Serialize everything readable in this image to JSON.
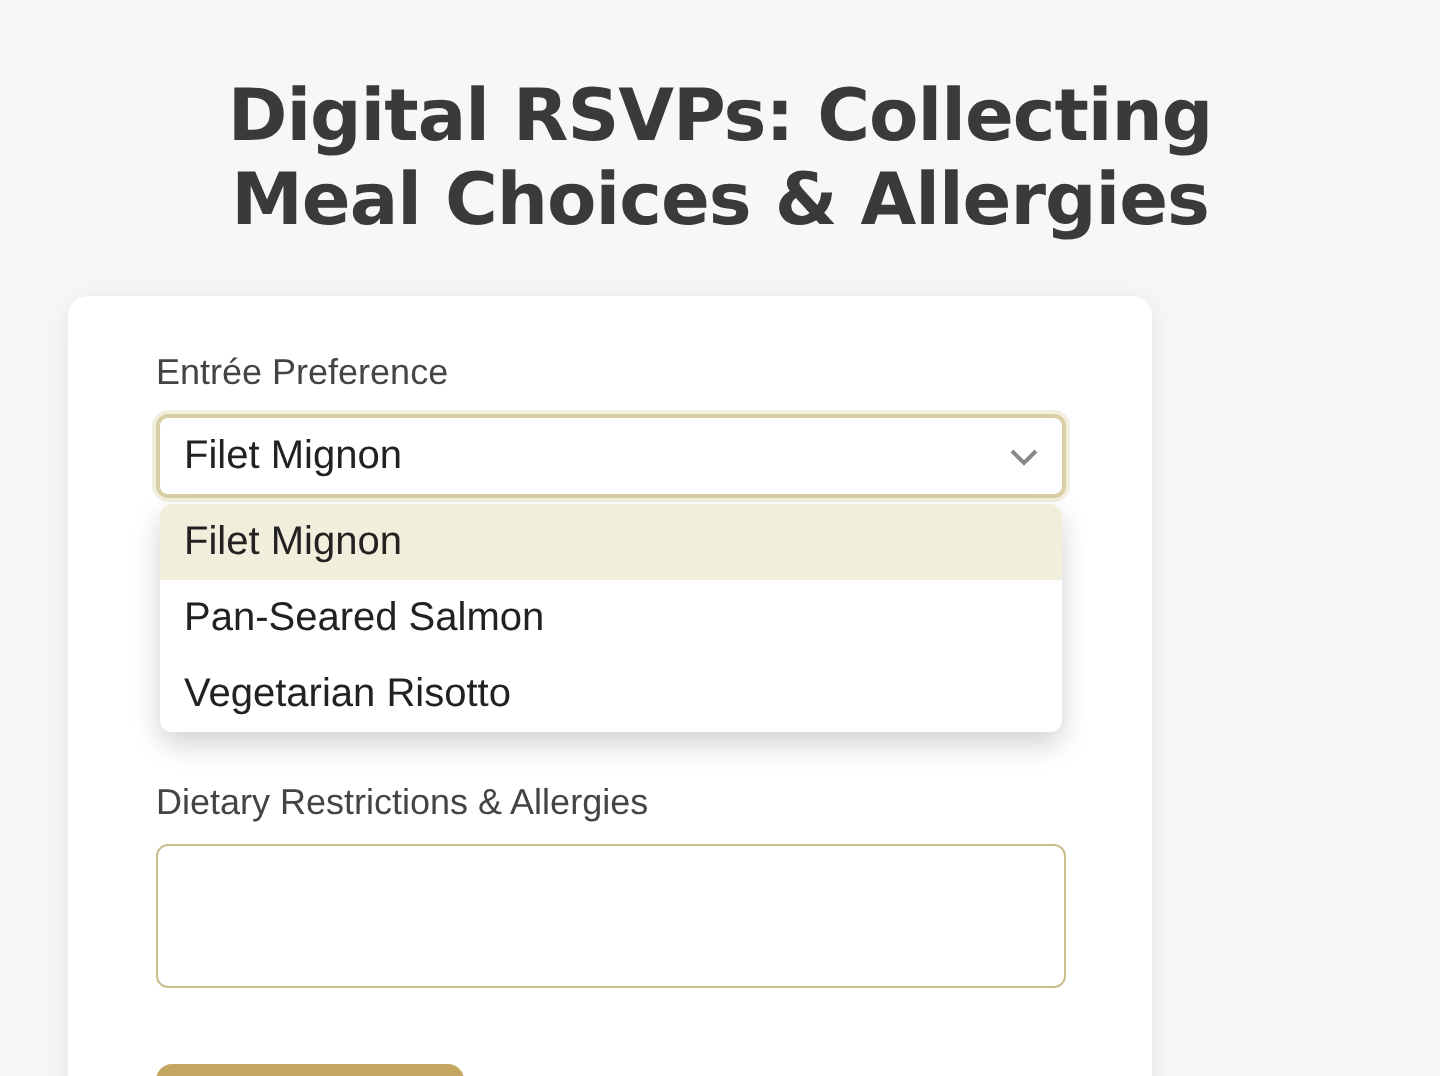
{
  "title": [
    "Digital RSVPs: Collecting",
    "Meal Choices & Allergies"
  ],
  "entree": {
    "label": "Entrée Preference",
    "value": "Filet Mignon",
    "expanded": true,
    "options": [
      {
        "label": "Filet Mignon",
        "selected": true
      },
      {
        "label": "Pan-Seared Salmon",
        "selected": false
      },
      {
        "label": "Vegetarian Risotto",
        "selected": false
      }
    ]
  },
  "dietary": {
    "label": "Dietary Restrictions & Allergies"
  },
  "submit": {
    "kind": "button"
  }
}
